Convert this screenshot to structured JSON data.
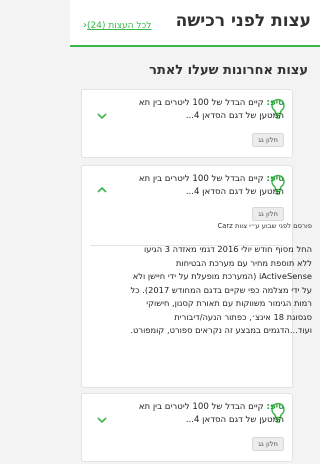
{
  "header": {
    "title": "עצות לפני רכישה",
    "all_tips_link": "לכל העצות (24)"
  },
  "section": {
    "title": "עצות אחרונות שעלו לאתר"
  },
  "tips": [
    {
      "label": "טיפ:",
      "text": "קיים הבדל של 100 ליטרים בין תא המטען של דגם הסדאן 4...",
      "tag": "חלון גג",
      "expanded": false
    },
    {
      "label": "טיפ:",
      "text": "קיים הבדל של 100 ליטרים בין תא המטען של דגם הסדאן 4...",
      "tag": "חלון גג",
      "expanded": true,
      "author": "פורסם לפני שבוע ע״י צוות Carz",
      "body": "החל מסוף חודש יולי 2016 דגמי מאזדה 3 הגיעו ללא תוספת מחיר עם מערכת הבטיחות iActiveSense (המערכת מופעלת על ידי חיישן ולא על ידי מצלמה כפי שקיים בדגם המחודש 2017). כל רמות הגימור משווקות עם תאורת קסנון, חישוקי סגסוגת 18 אינצ׳, כפתור הנעה/דיבורית ועוד...הדגמים במבצע זה נקראים ספורט, קומפורט."
    },
    {
      "label": "טיפ:",
      "text": "קיים הבדל של 100 ליטרים בין תא המטען של דגם הסדאן 4...",
      "tag": "חלון גג",
      "expanded": false
    }
  ],
  "icons": {
    "tip": "lightbulb-icon",
    "expand": "chevron-down-icon",
    "collapse": "chevron-up-icon",
    "link": "chevron-left-icon"
  },
  "colors": {
    "accent": "#3bb54a",
    "tip_label": "#2e9e3e"
  }
}
